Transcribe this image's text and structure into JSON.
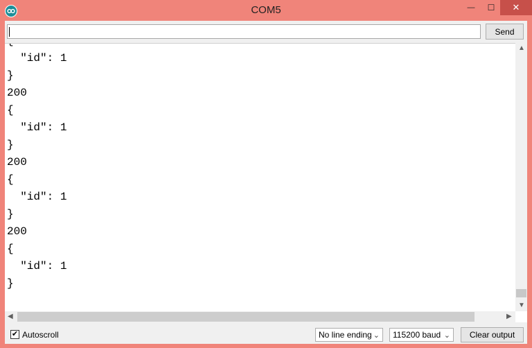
{
  "window": {
    "title": "COM5",
    "minimize_glyph": "—",
    "maximize_glyph": "☐",
    "close_glyph": "✕"
  },
  "send_bar": {
    "input_value": "",
    "send_label": "Send"
  },
  "output": {
    "lines": [
      "{",
      "  \"id\": 1",
      "}",
      "200",
      "{",
      "  \"id\": 1",
      "}",
      "200",
      "{",
      "  \"id\": 1",
      "}",
      "200",
      "{",
      "  \"id\": 1",
      "}"
    ]
  },
  "bottom_bar": {
    "autoscroll_label": "Autoscroll",
    "autoscroll_checked": true,
    "line_ending": "No line ending",
    "baud_rate": "115200 baud",
    "clear_label": "Clear output"
  },
  "icons": {
    "app": "arduino-icon",
    "scroll_up": "▲",
    "scroll_down": "▼",
    "scroll_left": "◀",
    "scroll_right": "▶",
    "dropdown": "⌄",
    "check": "✔"
  },
  "colors": {
    "titlebar": "#f0847a",
    "close_button": "#c7504a"
  }
}
